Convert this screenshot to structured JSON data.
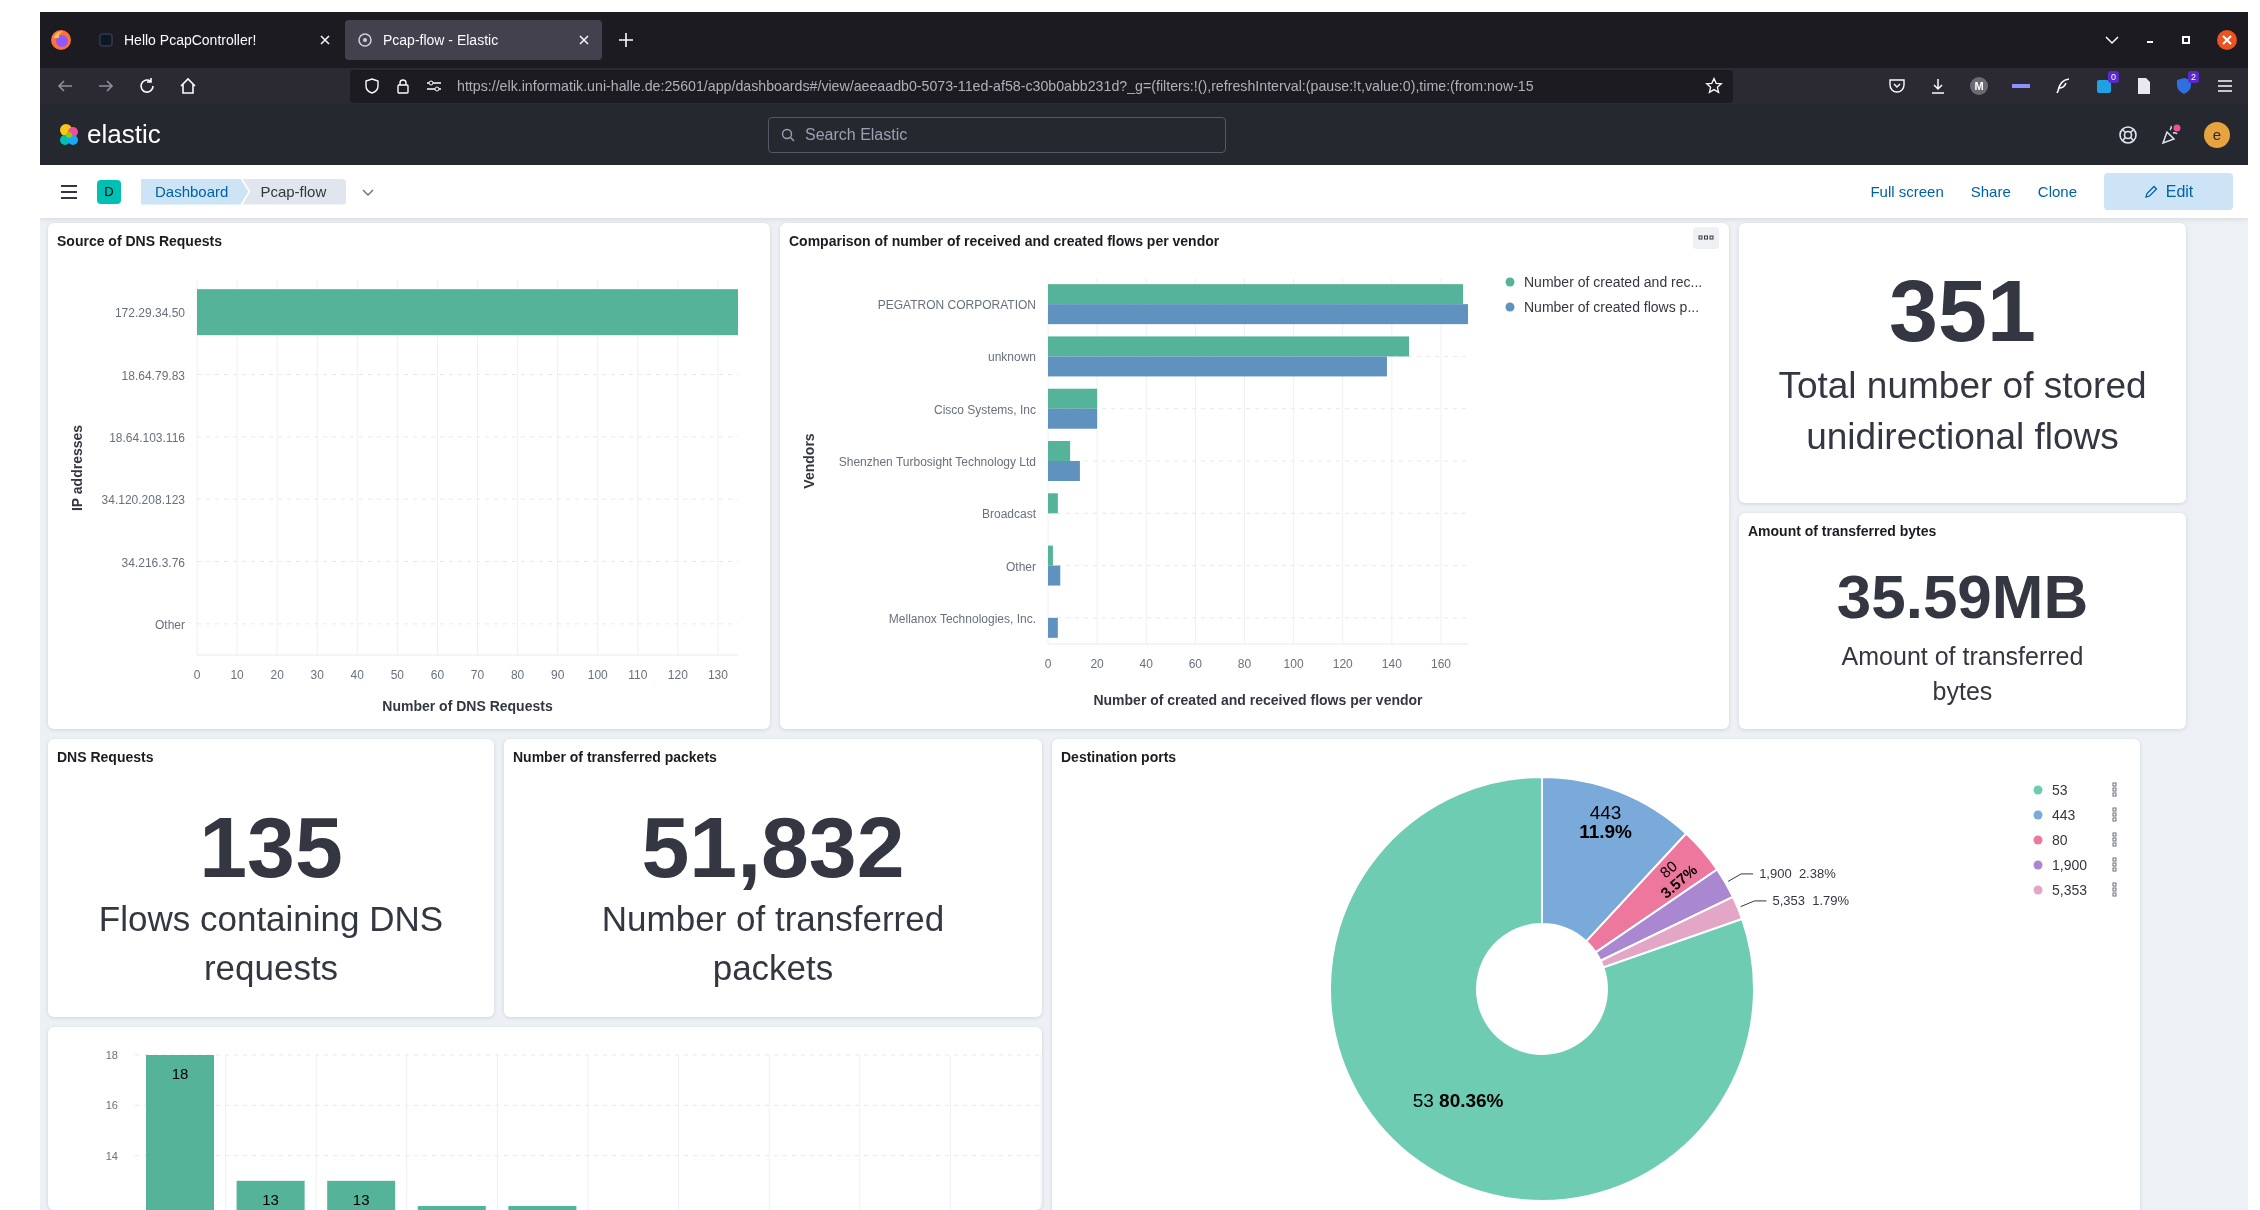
{
  "browser": {
    "tabs": [
      {
        "title": "Hello PcapController!",
        "selected": false
      },
      {
        "title": "Pcap-flow - Elastic",
        "selected": true
      }
    ],
    "url": "https://elk.informatik.uni-halle.de:25601/app/dashboards#/view/aeeaadb0-5073-11ed-af58-c30b0abb231d?_g=(filters:!(),refreshInterval:(pause:!t,value:0),time:(from:now-15",
    "profile_initial": "M",
    "badges": [
      "0",
      "2"
    ]
  },
  "header": {
    "logo": "elastic",
    "search": {
      "placeholder": "Search Elastic"
    },
    "news_unread": true,
    "avatar": "e"
  },
  "breadcrumb_bar": {
    "space": "D",
    "crumbs": [
      {
        "label": "Dashboard"
      },
      {
        "label": "Pcap-flow"
      }
    ],
    "actions": [
      "Full screen",
      "Share",
      "Clone"
    ],
    "edit": "Edit"
  },
  "dns_sources": {
    "title": "Source of DNS Requests",
    "chart_data": {
      "type": "bar",
      "orientation": "horizontal",
      "xlabel": "Number of DNS Requests",
      "ylabel": "IP addresses",
      "categories": [
        "172.29.34.50",
        "18.64.79.83",
        "18.64.103.116",
        "34.120.208.123",
        "34.216.3.76",
        "Other"
      ],
      "values": [
        135,
        0,
        0,
        0,
        0,
        0
      ],
      "xlim": [
        0,
        135
      ],
      "grid": true,
      "xticks": [
        0,
        10,
        20,
        30,
        40,
        50,
        60,
        70,
        80,
        90,
        100,
        110,
        120,
        130
      ]
    }
  },
  "vendor_flows": {
    "title": "Comparison of number of received and created flows per vendor",
    "chart_data": {
      "type": "bar",
      "orientation": "horizontal",
      "xlabel": "Number of created and received flows per vendor",
      "ylabel": "Vendors",
      "categories": [
        "PEGATRON CORPORATION",
        "unknown",
        "Cisco Systems, Inc",
        "Shenzhen Turbosight Technology Ltd",
        "Broadcast",
        "Other",
        "Mellanox Technologies, Inc."
      ],
      "series": [
        {
          "name": "Number of created and rec...",
          "color": "#54b399",
          "values": [
            169,
            147,
            20,
            9,
            4,
            2,
            null
          ]
        },
        {
          "name": "Number of created flows p...",
          "color": "#6092c0",
          "values": [
            171,
            138,
            20,
            13,
            null,
            5,
            4
          ]
        }
      ],
      "xlim": [
        0,
        171
      ],
      "xticks": [
        0,
        20,
        40,
        60,
        80,
        100,
        120,
        140,
        160
      ],
      "grid": true,
      "legend": "right"
    }
  },
  "metrics": [
    {
      "value": "351",
      "label": "Total number of stored unidirectional flows"
    },
    {
      "title": "Amount of transferred bytes",
      "value": "35.59MB",
      "label": "Amount of transferred bytes"
    },
    {
      "title": "DNS Requests",
      "value": "135",
      "label": "Flows containing DNS requests"
    },
    {
      "title": "Number of transferred packets",
      "value": "51,832",
      "label": "Number of transferred packets"
    }
  ],
  "destination_ports": {
    "title": "Destination ports",
    "chart_data": {
      "type": "donut",
      "categories": [
        "53",
        "443",
        "80",
        "1,900",
        "5,353"
      ],
      "values": [
        80.36,
        11.9,
        3.57,
        2.38,
        1.79
      ],
      "value_labels": [
        "80.36%",
        "11.9%",
        "3.57%",
        "2.38%",
        "1.79%"
      ],
      "legend": "right"
    },
    "legend": [
      {
        "label": "53",
        "color": "#6dccb1"
      },
      {
        "label": "443",
        "color": "#79aad9"
      },
      {
        "label": "80",
        "color": "#ee789d"
      },
      {
        "label": "1,900",
        "color": "#a987d1"
      },
      {
        "label": "5,353",
        "color": "#e4a6c7"
      }
    ]
  },
  "request_histogram": {
    "chart_data": {
      "type": "bar",
      "values": [
        18,
        13,
        13,
        12,
        12,
        null,
        null,
        null,
        null,
        null
      ],
      "ylim": [
        11.84,
        18
      ],
      "yticks": [
        14,
        16,
        18
      ],
      "grid": true,
      "value_labels": [
        "18",
        "13",
        "13",
        null,
        null,
        null,
        null,
        null,
        null,
        null
      ]
    }
  }
}
